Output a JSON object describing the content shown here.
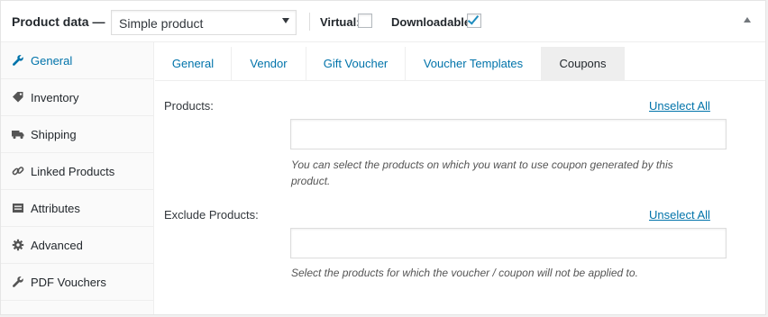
{
  "header": {
    "title": "Product data —",
    "product_type": "Simple product",
    "virtual_label": "Virtual:",
    "virtual_checked": false,
    "downloadable_label": "Downloadable:",
    "downloadable_checked": true
  },
  "sidebar": {
    "items": [
      {
        "label": "General",
        "icon": "wrench-icon"
      },
      {
        "label": "Inventory",
        "icon": "tag-icon"
      },
      {
        "label": "Shipping",
        "icon": "truck-icon"
      },
      {
        "label": "Linked Products",
        "icon": "link-icon"
      },
      {
        "label": "Attributes",
        "icon": "list-icon"
      },
      {
        "label": "Advanced",
        "icon": "gear-icon"
      },
      {
        "label": "PDF Vouchers",
        "icon": "wrench-icon"
      }
    ]
  },
  "tabs": [
    {
      "label": "General"
    },
    {
      "label": "Vendor"
    },
    {
      "label": "Gift Voucher"
    },
    {
      "label": "Voucher Templates"
    },
    {
      "label": "Coupons",
      "active": true
    }
  ],
  "coupons": {
    "products_label": "Products:",
    "products_unselect": "Unselect All",
    "products_value": "",
    "products_desc": "You can select the products on which you want to use coupon generated by this product.",
    "exclude_label": "Exclude Products:",
    "exclude_unselect": "Unselect All",
    "exclude_value": "",
    "exclude_desc": "Select the products for which the voucher / coupon will not be applied to."
  },
  "colors": {
    "link": "#0073aa",
    "text": "#23282d",
    "active_tab_bg": "#eeeeee",
    "sidebar_bg": "#fafafa"
  }
}
